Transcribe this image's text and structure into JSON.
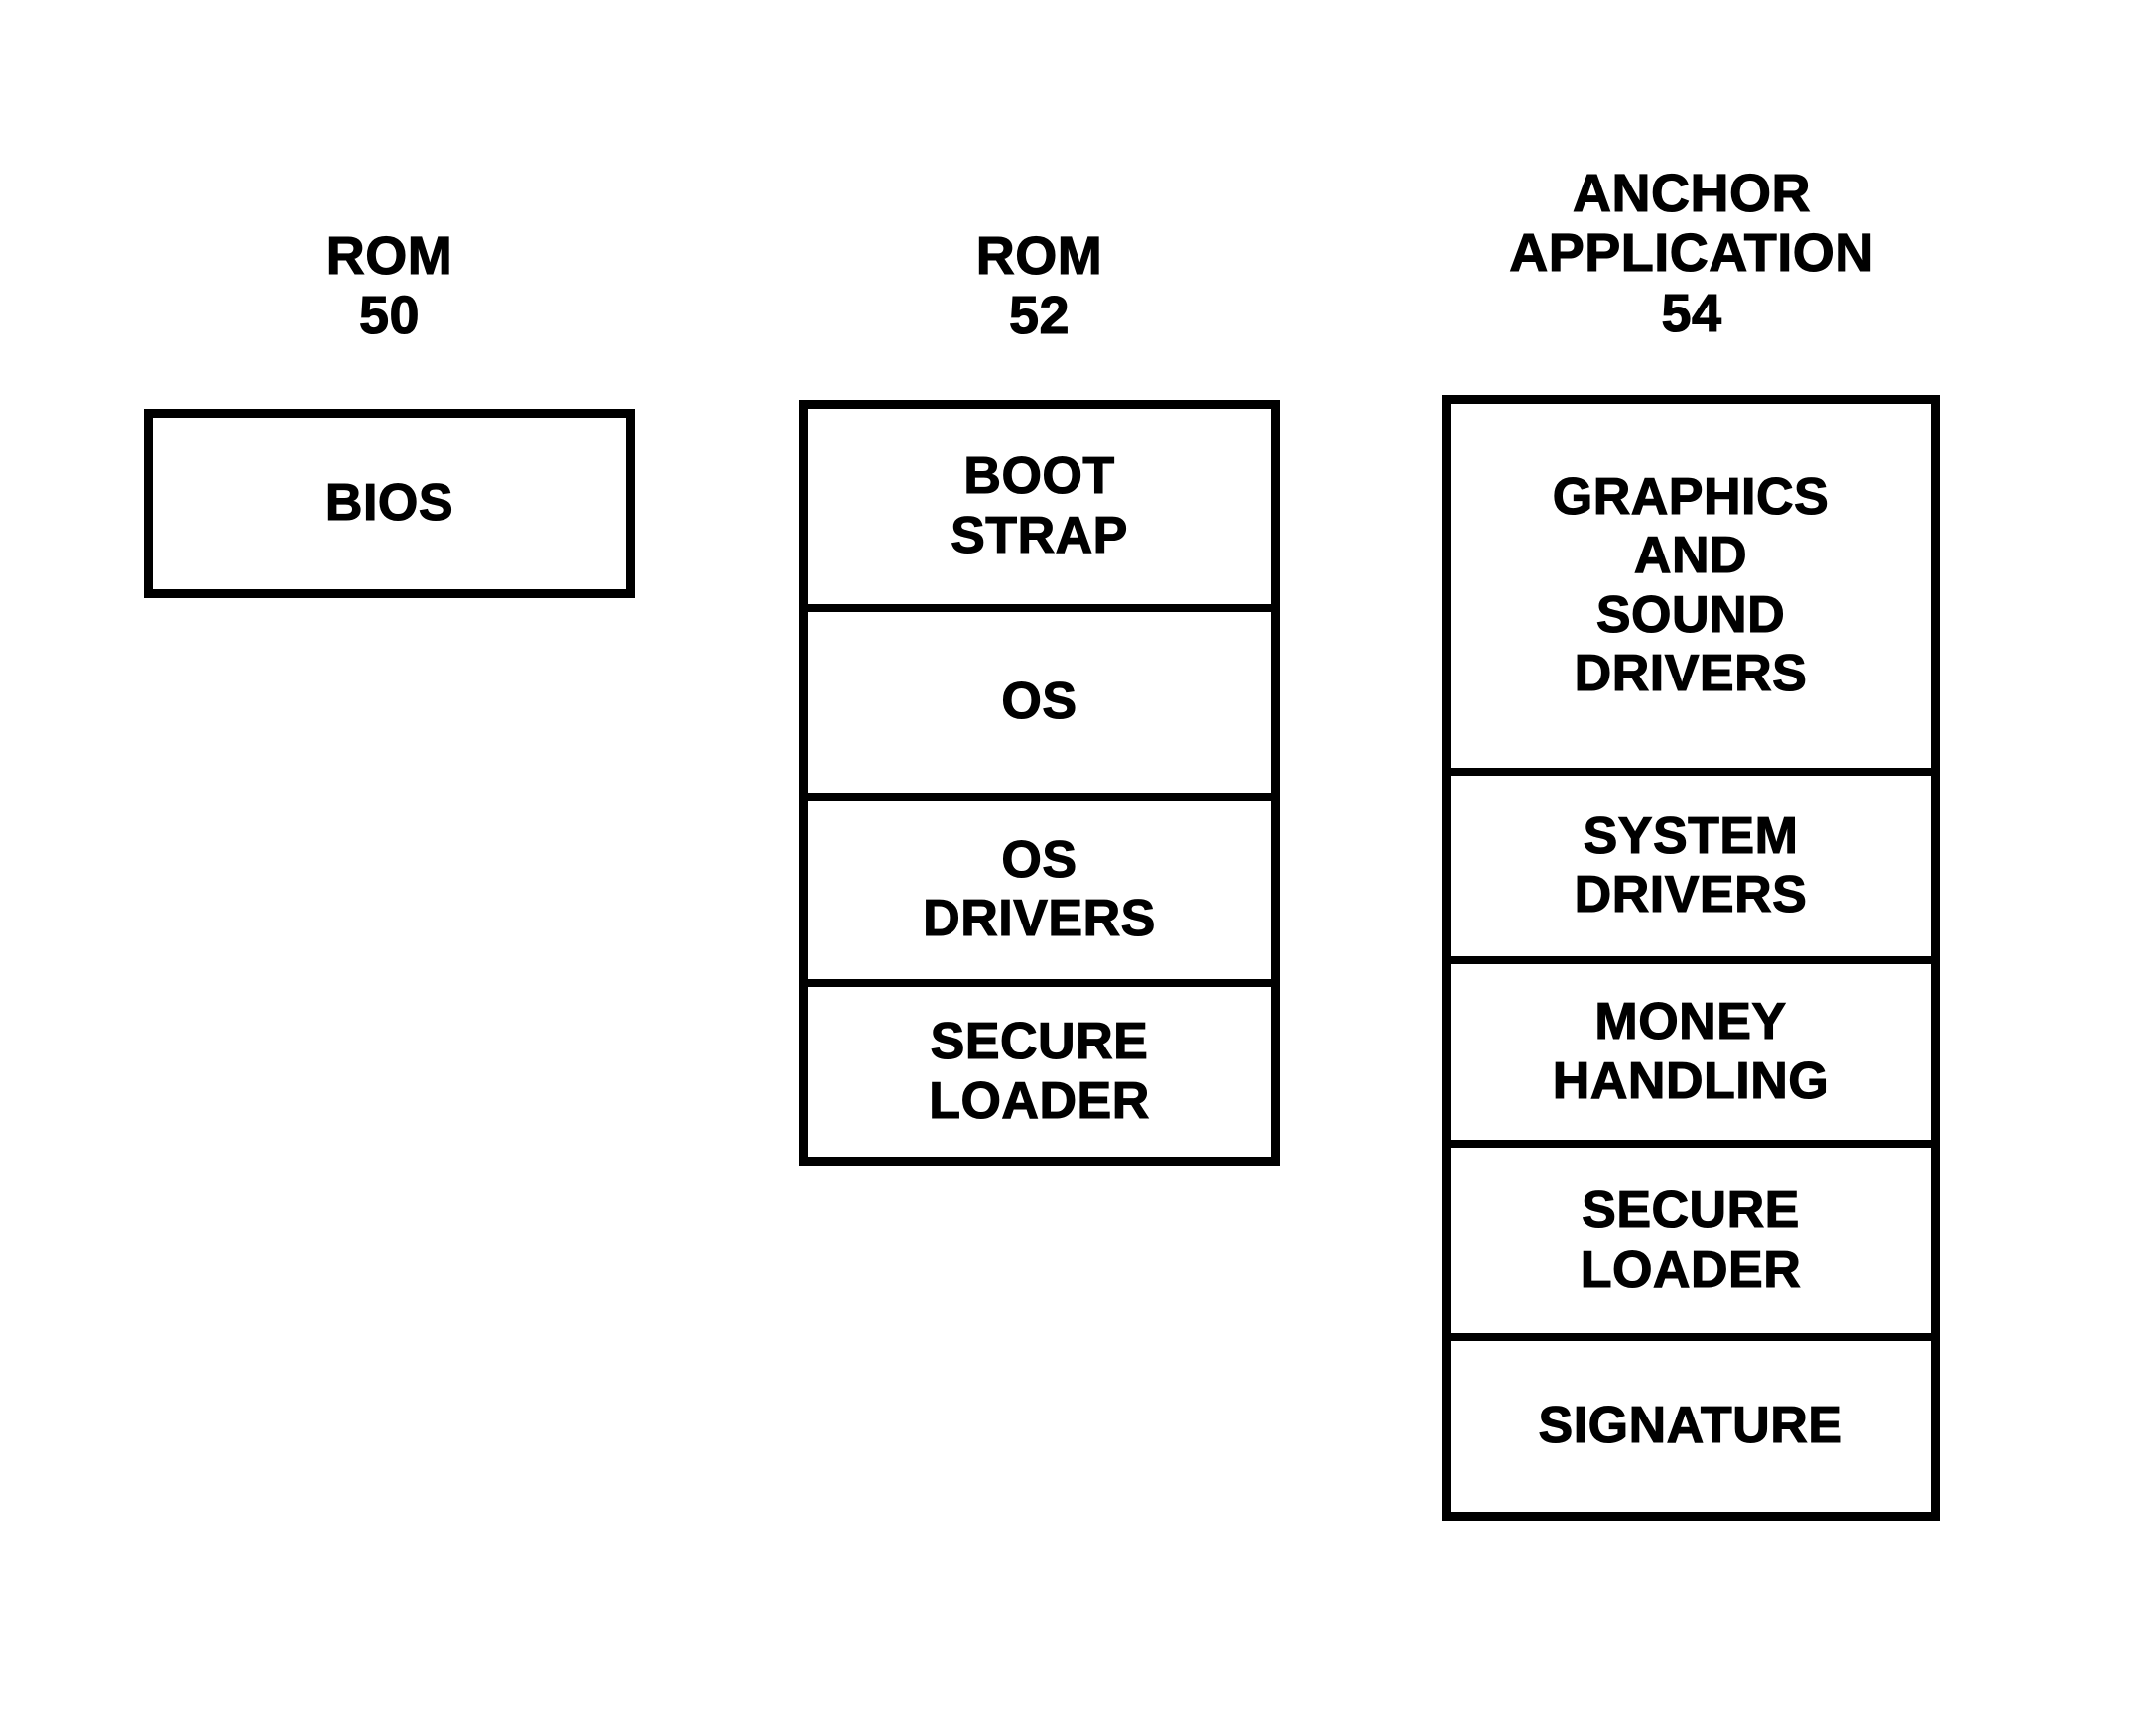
{
  "figure": {
    "title": "Memory / software layout block diagram",
    "background_color": "#ffffff",
    "line_color": "#000000"
  },
  "columns": [
    {
      "id": "rom-50",
      "title": "ROM\n50",
      "title_lines": [
        "ROM",
        "50"
      ],
      "reference_numeral": "50",
      "cells": [
        {
          "label": "BIOS"
        }
      ]
    },
    {
      "id": "rom-52",
      "title": "ROM\n52",
      "title_lines": [
        "ROM",
        "52"
      ],
      "reference_numeral": "52",
      "cells": [
        {
          "label": "BOOT\nSTRAP"
        },
        {
          "label": "OS"
        },
        {
          "label": "OS\nDRIVERS"
        },
        {
          "label": "SECURE\nLOADER"
        }
      ]
    },
    {
      "id": "anchor-application-54",
      "title": "ANCHOR\nAPPLICATION\n54",
      "title_lines": [
        "ANCHOR",
        "APPLICATION",
        "54"
      ],
      "reference_numeral": "54",
      "cells": [
        {
          "label": "GRAPHICS\nAND\nSOUND\nDRIVERS"
        },
        {
          "label": "SYSTEM\nDRIVERS"
        },
        {
          "label": "MONEY\nHANDLING"
        },
        {
          "label": "SECURE\nLOADER"
        },
        {
          "label": "SIGNATURE"
        }
      ]
    }
  ]
}
